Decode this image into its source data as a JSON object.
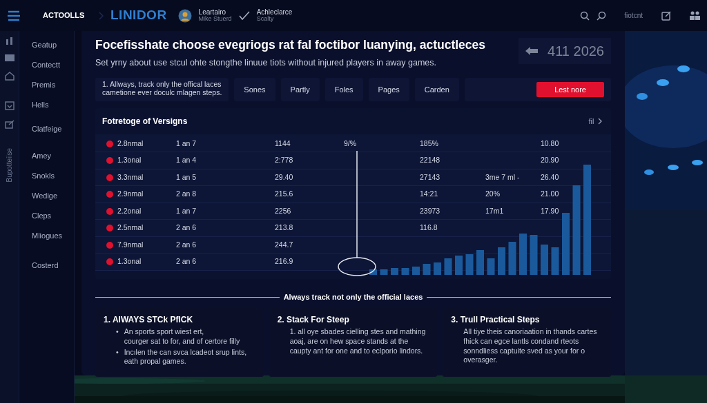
{
  "top_bar": {
    "brand": "ACTOOLLS",
    "logo": "LINIDOR",
    "user": {
      "name": "Leartairo",
      "subtitle": "Mike Stuerd"
    },
    "status": {
      "label": "Achleclarce",
      "subtitle": "Scalty"
    },
    "link": "fiotcnt"
  },
  "rail": {
    "vertical_label": "Bupotteiise"
  },
  "sidebar": {
    "items": [
      "Geatup",
      "Contectt",
      "Premis",
      "Hells",
      "Clatfeige",
      "Amey",
      "Snokls",
      "Wedige",
      "Cleps",
      "Mliogues",
      "Costerd"
    ]
  },
  "heading": "Focefisshate choose evegriogs rat fal foctibor luanying, actuctleces",
  "subtitle": "Set yrny about use stcul ohte stongthe linuue tiots without injured players in away games.",
  "date_box": {
    "text": "411 2026"
  },
  "note": "1. Allways, track only the offical laces\ncametione ever doculc mlagen steps.",
  "filters": [
    "Sones",
    "Partly",
    "Foles",
    "Pages",
    "Carden"
  ],
  "primary_button": "Lest nore",
  "table": {
    "title": "Fotretoge of Versigns",
    "filter_label": "fil",
    "rows": [
      {
        "cells": [
          "2.8nmal",
          "1 an 7",
          "1144",
          "9/%",
          "185%",
          "",
          "10.80"
        ]
      },
      {
        "cells": [
          "1.3onal",
          "1 an 4",
          "2:778",
          "",
          "22148",
          "",
          "20.90"
        ]
      },
      {
        "cells": [
          "3.3nmal",
          "1 an 5",
          "29.40",
          "",
          "27143",
          "3me 7 ml -",
          "26.40"
        ]
      },
      {
        "cells": [
          "2.9nmal",
          "2 an 8",
          "215.6",
          "",
          "14:21",
          "20%",
          "21.00"
        ]
      },
      {
        "cells": [
          "2.2onal",
          "1 an 7",
          "2256",
          "",
          "23973",
          "17m1",
          "17.90"
        ]
      },
      {
        "cells": [
          "2.5nmal",
          "2 an 6",
          "213.8",
          "",
          "116.8",
          "",
          ""
        ]
      },
      {
        "cells": [
          "7.9nmal",
          "2 an 6",
          "244.7",
          "",
          "",
          "",
          ""
        ]
      },
      {
        "cells": [
          "1.3onal",
          "2 an 6",
          "216.9",
          "",
          "",
          "",
          ""
        ]
      }
    ]
  },
  "divider_label": "Always track not only the official laces",
  "steps": [
    {
      "number": "1.",
      "title": "AIWAYS STCk PfICK",
      "kind": "bullets",
      "bullet": "•",
      "lines": [
        "An sports sport wiest ert,\ncourger sat to for, and of certore filly",
        "Incılen the can svca lcadeot srup lints,\neath propal games."
      ]
    },
    {
      "number": "2.",
      "title": "Stack For Steep",
      "kind": "text",
      "lines": [
        "1. all oye sbades cielling stes and mathing aoaj, are on hew space stands at the caupty ant for one and to eclporio lindors."
      ]
    },
    {
      "number": "3.",
      "title": "Trull Practical Steps",
      "kind": "text",
      "lines": [
        "All tiye theis canoriaation in thands cartes fhick can egce lantls condand rteots sonndliess captuite sved as your for o overasger."
      ]
    }
  ]
}
